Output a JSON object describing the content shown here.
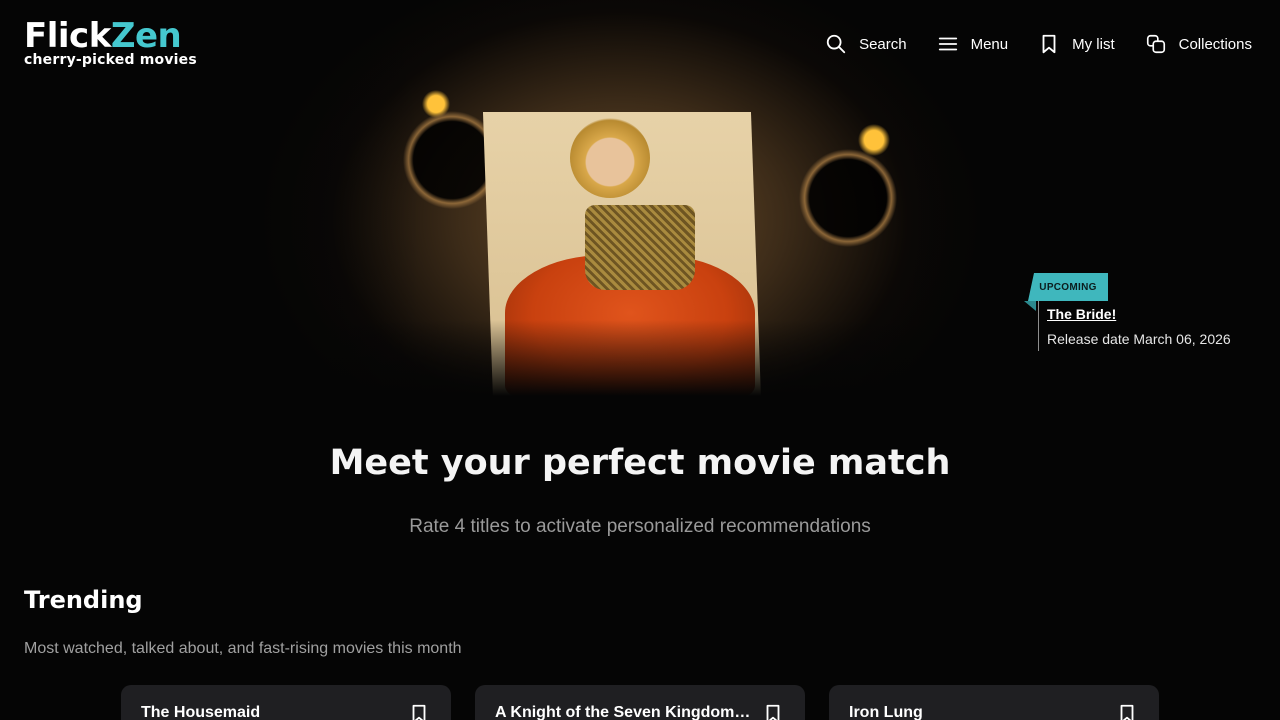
{
  "brand": {
    "name_part1": "Flick",
    "name_part2": "Zen",
    "tagline": "cherry-picked movies",
    "accent_color": "#45c8cf"
  },
  "nav": {
    "items": [
      {
        "label": "Search",
        "icon": "search-icon"
      },
      {
        "label": "Menu",
        "icon": "menu-icon"
      },
      {
        "label": "My list",
        "icon": "bookmark-icon"
      },
      {
        "label": "Collections",
        "icon": "collections-icon"
      }
    ]
  },
  "hero": {
    "badge": "UPCOMING",
    "title": "The Bride!",
    "release_date": "Release date March 06, 2026"
  },
  "main": {
    "headline": "Meet your perfect movie match",
    "subline": "Rate 4 titles to activate personalized recommendations"
  },
  "trending": {
    "title": "Trending",
    "description": "Most watched, talked about, and fast-rising movies this month",
    "cards": [
      {
        "title": "The Housemaid"
      },
      {
        "title": "A Knight of the Seven Kingdoms: The Hedge Knight"
      },
      {
        "title": "Iron Lung"
      }
    ]
  }
}
